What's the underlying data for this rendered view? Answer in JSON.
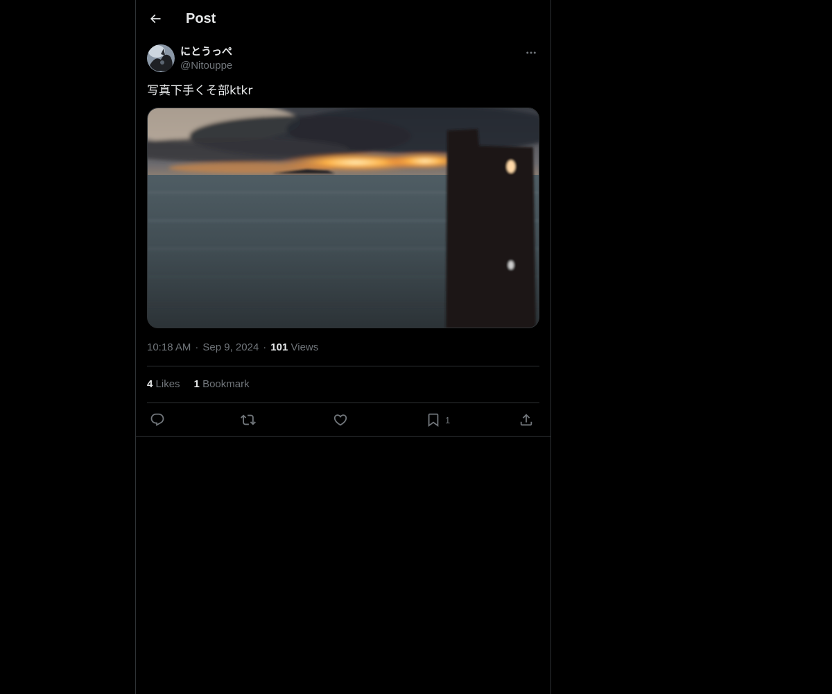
{
  "header": {
    "title": "Post",
    "back_icon": "arrow-left-icon"
  },
  "author": {
    "display_name": "にとうっぺ",
    "handle": "@Nitouppe",
    "more_icon": "more-horizontal-icon"
  },
  "post": {
    "text": "写真下手くそ部ktkr",
    "media_description": "blurry sunset over the sea behind a dark wooden post"
  },
  "meta": {
    "time": "10:18 AM",
    "date": "Sep 9, 2024",
    "separator": "·",
    "views_count": "101",
    "views_label": "Views"
  },
  "stats": {
    "likes_count": "4",
    "likes_label": "Likes",
    "bookmarks_count": "1",
    "bookmarks_label": "Bookmark"
  },
  "actions": {
    "reply_icon": "reply-icon",
    "repost_icon": "repost-icon",
    "like_icon": "heart-icon",
    "bookmark_icon": "bookmark-icon",
    "bookmark_count": "1",
    "share_icon": "share-icon"
  },
  "colors": {
    "background": "#000000",
    "text_primary": "#e7e9ea",
    "text_secondary": "#71767b",
    "border": "#2f3336"
  }
}
